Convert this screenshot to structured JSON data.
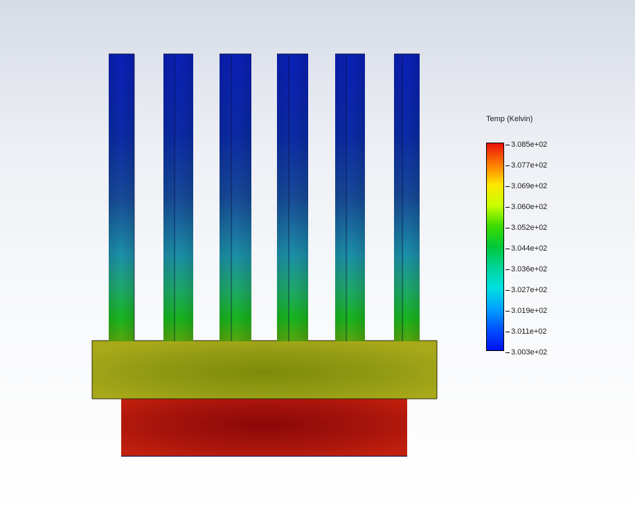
{
  "legend": {
    "title": "Temp (Kelvin)",
    "labels": [
      "3.085e+02",
      "3.077e+02",
      "3.069e+02",
      "3.060e+02",
      "3.052e+02",
      "3.044e+02",
      "3.036e+02",
      "3.027e+02",
      "3.019e+02",
      "3.011e+02",
      "3.003e+02"
    ],
    "max": 308.5,
    "min": 300.3,
    "colors": [
      "#e8110d",
      "#ff7a00",
      "#ffe600",
      "#c8ff00",
      "#3ddc00",
      "#00c83a",
      "#00d49a",
      "#00e0e0",
      "#00a0ff",
      "#0050ff",
      "#0010f0"
    ]
  },
  "model": {
    "fin_count": 6,
    "base_color": "#9a9f18",
    "source_color": "#b0160e",
    "fin_tip_color": "#0a2aa8",
    "fin_root_color": "#16b818"
  }
}
